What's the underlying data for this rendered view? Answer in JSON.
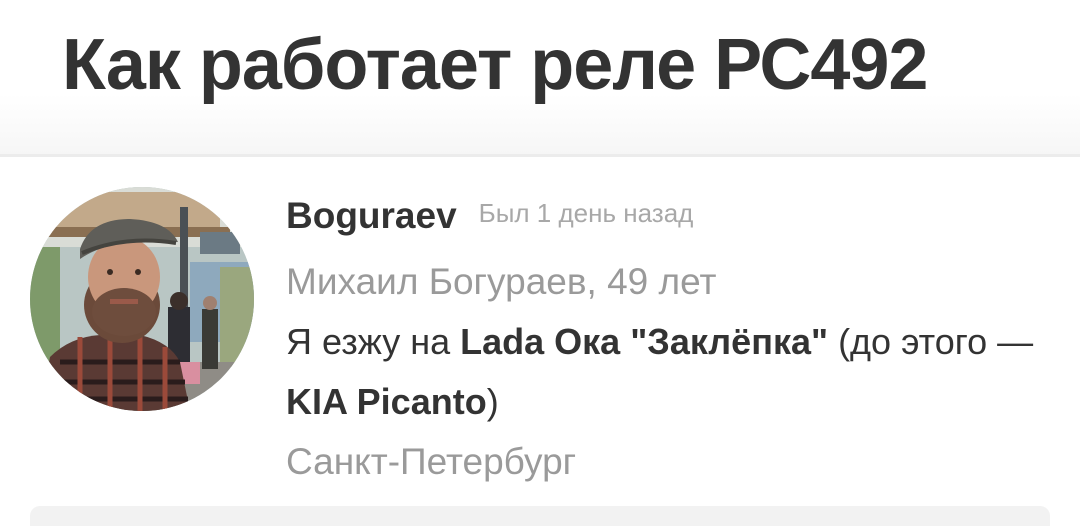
{
  "page": {
    "title": "Как работает реле РС492"
  },
  "profile": {
    "avatar_alt": "avatar",
    "username": "Boguraev",
    "last_seen": "Был 1 день назад",
    "real_name_age": "Михаил Богураев, 49 лет",
    "cars": {
      "prefix": "Я езжу на ",
      "current_car": "Lada Ока \"Заклёпка\"",
      "middle": " (до этого —",
      "previous_car": "KIA Picanto",
      "suffix": ")"
    },
    "city": "Санкт-Петербург"
  },
  "colors": {
    "title": "#333333",
    "muted": "#9a9a9a",
    "last_seen": "#a8a8a8"
  }
}
